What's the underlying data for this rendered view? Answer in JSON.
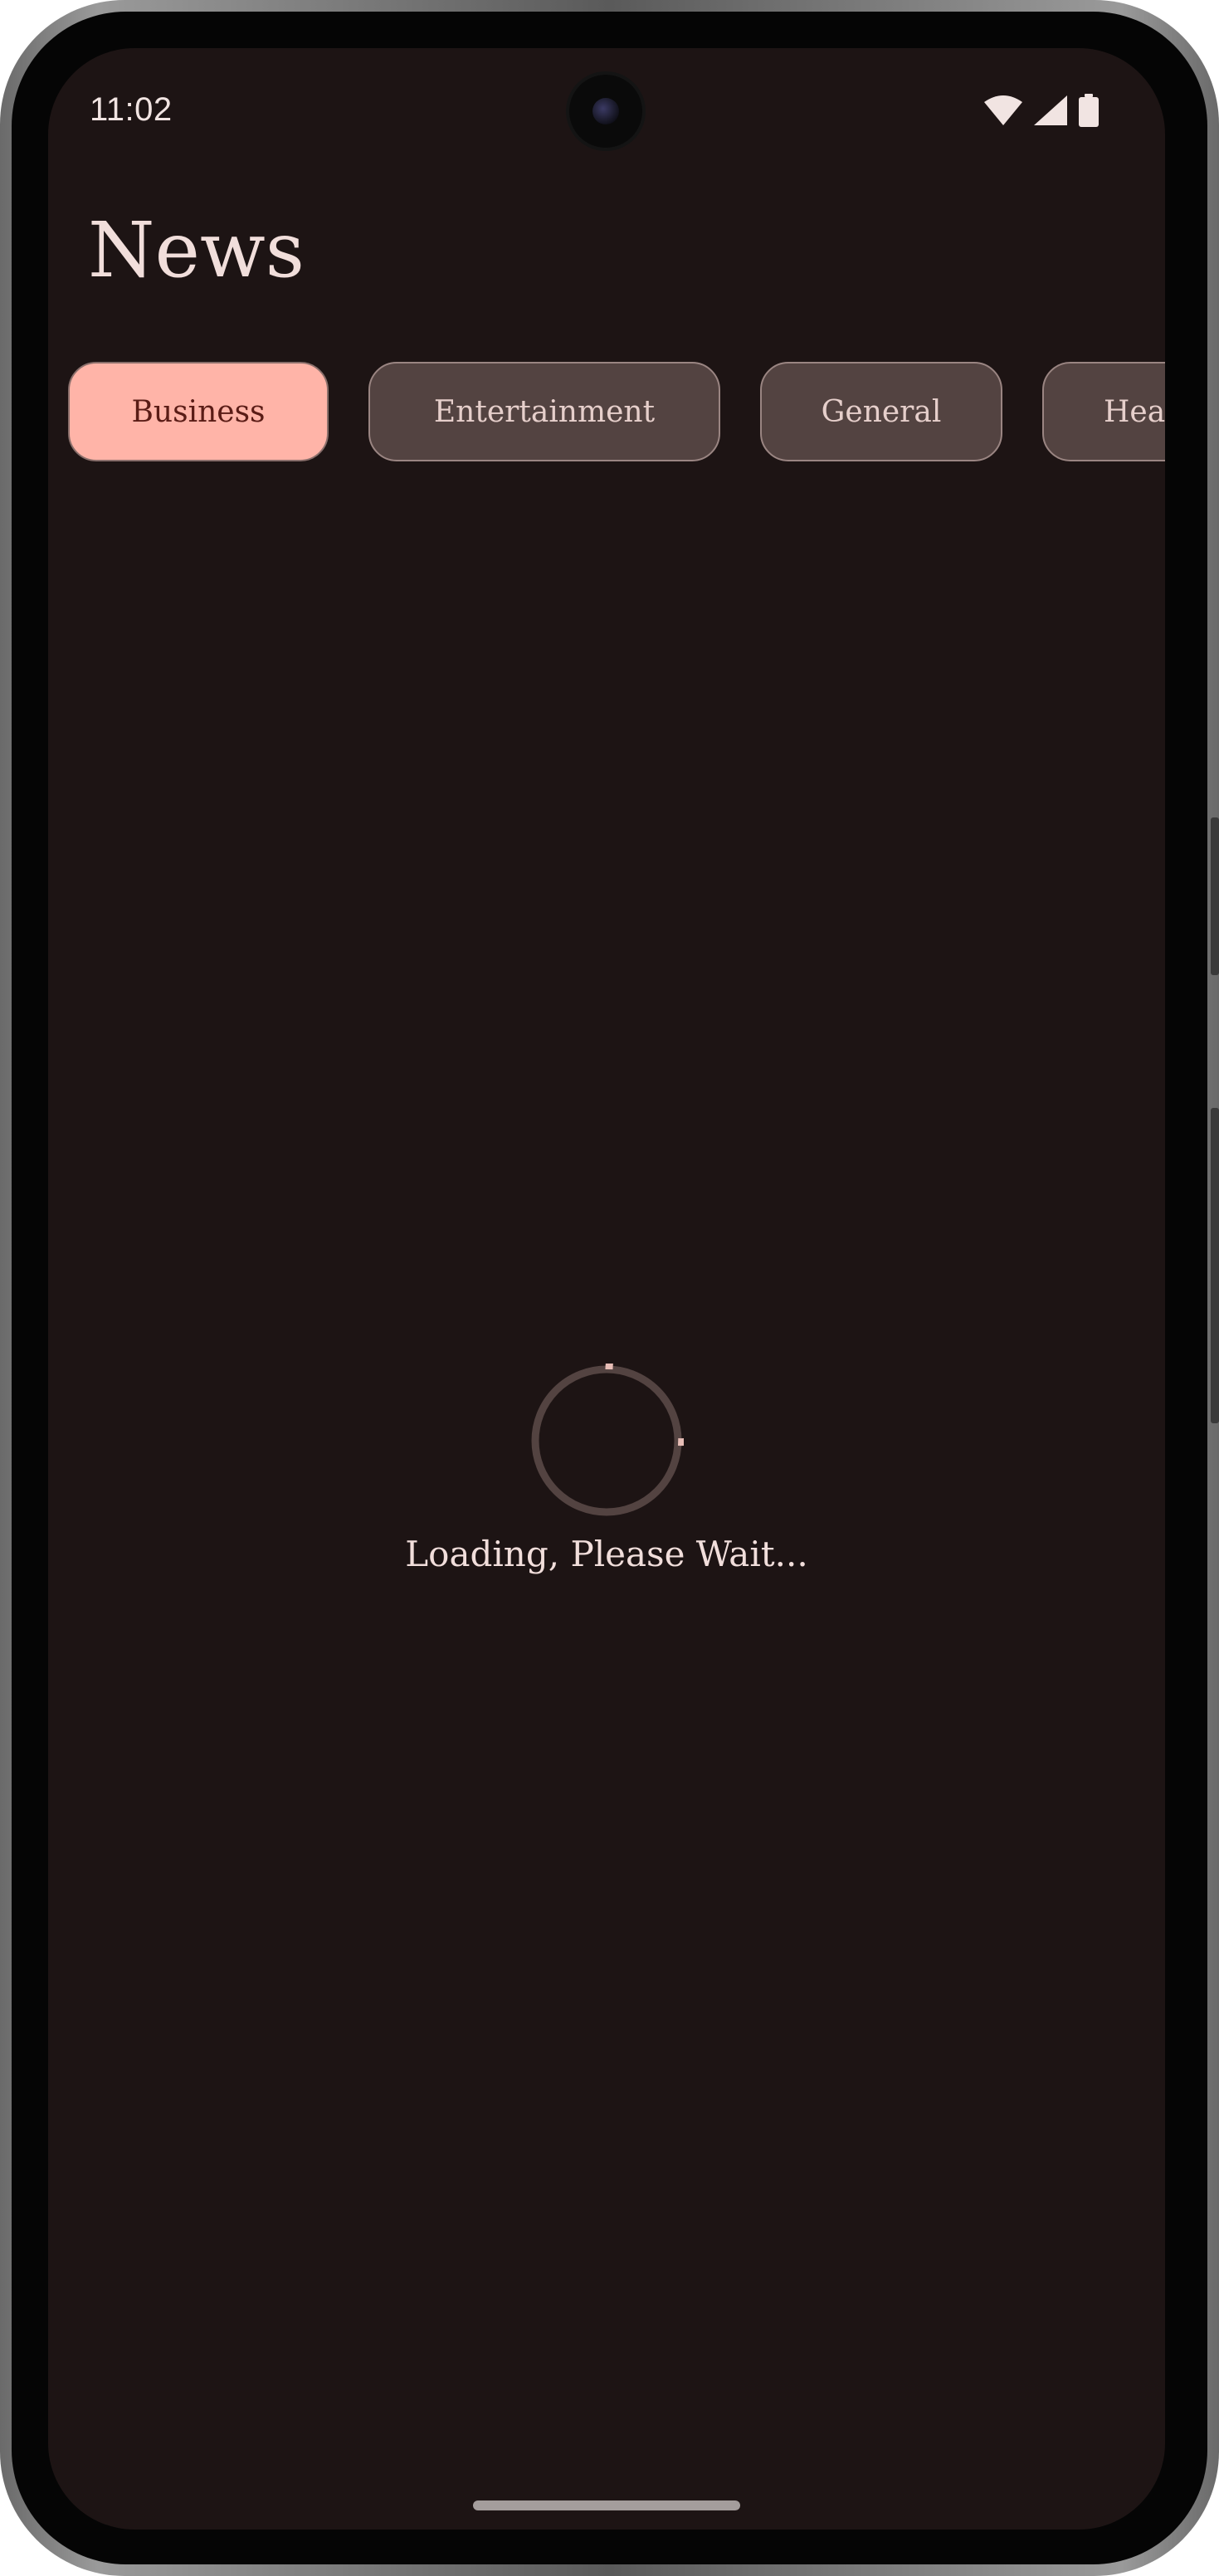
{
  "status_bar": {
    "time": "11:02",
    "icons": [
      "wifi-icon",
      "cellular-signal-icon",
      "battery-icon"
    ]
  },
  "header": {
    "title": "News"
  },
  "categories": [
    {
      "label": "Business",
      "selected": true
    },
    {
      "label": "Entertainment",
      "selected": false
    },
    {
      "label": "General",
      "selected": false
    },
    {
      "label": "Hea",
      "selected": false
    }
  ],
  "loading": {
    "text": "Loading, Please Wait..."
  },
  "colors": {
    "background": "#1d1414",
    "selected_chip": "#ffb4a8",
    "unselected_chip": "#534341",
    "spinner_arc": "#e7bdb6",
    "spinner_track": "#534341"
  }
}
